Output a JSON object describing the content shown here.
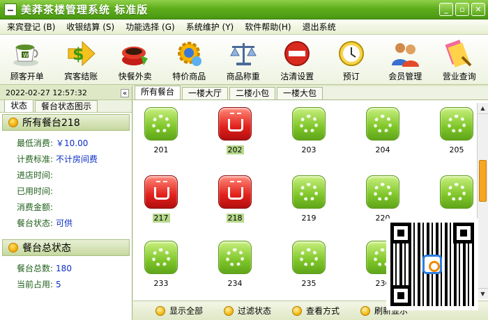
{
  "app": {
    "title": "美莽茶楼管理系统 标准版"
  },
  "menu": [
    "来宾登记 (B)",
    "收银结算 (S)",
    "功能选择 (G)",
    "系统维护 (Y)",
    "软件帮助(H)",
    "退出系统"
  ],
  "toolbar": [
    {
      "label": "顾客开单",
      "icon": "tea-cup-icon"
    },
    {
      "label": "宾客结账",
      "icon": "dollar-arrow-icon"
    },
    {
      "label": "快餐外卖",
      "icon": "takeout-cup-icon"
    },
    {
      "label": "特价商品",
      "icon": "gear-badge-icon"
    },
    {
      "label": "商品称重",
      "icon": "scale-icon"
    },
    {
      "label": "沽清设置",
      "icon": "no-entry-icon"
    },
    {
      "label": "预订",
      "icon": "clock-icon"
    },
    {
      "label": "会员管理",
      "icon": "members-icon"
    },
    {
      "label": "营业查询",
      "icon": "report-search-icon"
    }
  ],
  "left": {
    "datetime": "2022-02-27 12:57:32",
    "collapse": "«",
    "tabs": [
      "状态",
      "餐台状态图示"
    ],
    "section1": "所有餐台218",
    "min_spend_label": "最低消费:",
    "min_spend_value": "￥10.00",
    "charge_label": "计费标准:",
    "charge_value": "不计房间费",
    "enter_time_label": "进店时间:",
    "used_time_label": "已用时间:",
    "amount_label": "消费金额:",
    "state_label": "餐台状态:",
    "state_value": "可供",
    "section2": "餐台总状态",
    "total_label": "餐台总数:",
    "total_value": "180",
    "occupied_label": "当前占用:",
    "occupied_value": "5"
  },
  "main": {
    "tabs": [
      "所有餐台",
      "一楼大厅",
      "二楼小包",
      "一楼大包"
    ],
    "tables": [
      {
        "num": "201",
        "state": "free"
      },
      {
        "num": "202",
        "state": "busy"
      },
      {
        "num": "203",
        "state": "free"
      },
      {
        "num": "204",
        "state": "free"
      },
      {
        "num": "205",
        "state": "free"
      },
      {
        "num": "217",
        "state": "busy"
      },
      {
        "num": "218",
        "state": "busy"
      },
      {
        "num": "219",
        "state": "free"
      },
      {
        "num": "220",
        "state": "free"
      },
      {
        "num": "",
        "state": "free"
      },
      {
        "num": "233",
        "state": "free"
      },
      {
        "num": "234",
        "state": "free"
      },
      {
        "num": "235",
        "state": "free"
      },
      {
        "num": "236",
        "state": "free"
      }
    ],
    "bottom": [
      "显示全部",
      "过滤状态",
      "查看方式",
      "刷新显示"
    ]
  }
}
